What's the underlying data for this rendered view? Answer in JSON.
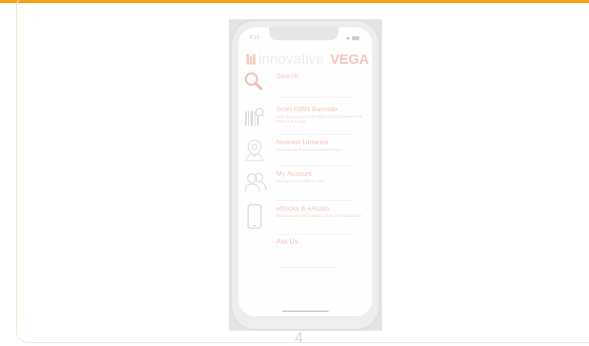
{
  "slide": {
    "page_number": "4"
  },
  "phone": {
    "status_time": "6:15",
    "logo_text": "innovative",
    "logo_product": "VEGA",
    "menu": [
      {
        "id": "search",
        "title": "Search",
        "description": "",
        "icon": "search-icon"
      },
      {
        "id": "scan",
        "title": "Scan ISBN Barcode",
        "description": "Scan the barcode on the back of a book to see if the library has a copy",
        "icon": "barcode-scan-icon"
      },
      {
        "id": "libraries",
        "title": "Nearest Libraries",
        "description": "Find a library branch convenient for you",
        "icon": "map-pin-icon"
      },
      {
        "id": "account",
        "title": "My Account",
        "description": "Manage loans, holds & more",
        "icon": "users-icon"
      },
      {
        "id": "ebooks",
        "title": "eBooks & eAudio",
        "description": "Download and read eBooks & listen to eAudiobooks",
        "icon": "tablet-icon"
      },
      {
        "id": "ask",
        "title": "Ask Us",
        "description": "",
        "icon": ""
      }
    ]
  }
}
